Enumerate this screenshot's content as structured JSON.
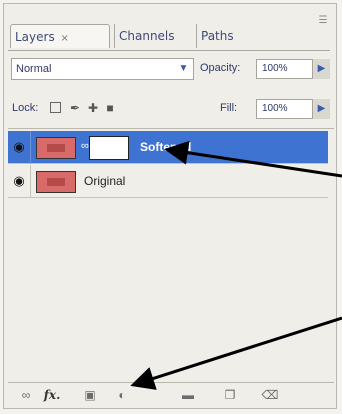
{
  "panel": {
    "tabs": [
      {
        "label": "Layers",
        "close": "×",
        "active": true
      },
      {
        "label": "Channels",
        "active": false
      },
      {
        "label": "Paths",
        "active": false
      }
    ],
    "menu_icon": "panel-menu-icon"
  },
  "blend": {
    "mode": "Normal",
    "opacity_label": "Opacity:",
    "opacity_value": "100%"
  },
  "lock": {
    "label": "Lock:",
    "icons": [
      "lock-transparent-icon",
      "lock-image-icon",
      "lock-position-icon",
      "lock-all-icon"
    ],
    "fill_label": "Fill:",
    "fill_value": "100%"
  },
  "layers": [
    {
      "name": "Softened",
      "visible": true,
      "selected": true,
      "has_mask": true,
      "eye_icon": "eye-icon"
    },
    {
      "name": "Original",
      "visible": true,
      "selected": false,
      "has_mask": false,
      "eye_icon": "eye-icon"
    }
  ],
  "toolbar": {
    "icons": [
      "link-layers-icon",
      "layer-style-fx-icon",
      "add-layer-mask-icon",
      "adjustment-layer-icon",
      "new-group-icon",
      "new-layer-icon",
      "trash-icon"
    ],
    "fx_text": "fx."
  },
  "colors": {
    "selection": "#3f73d1",
    "panel_bg": "#efeee9",
    "thumb": "#d86a6a",
    "accent_text": "#2f3a68"
  }
}
